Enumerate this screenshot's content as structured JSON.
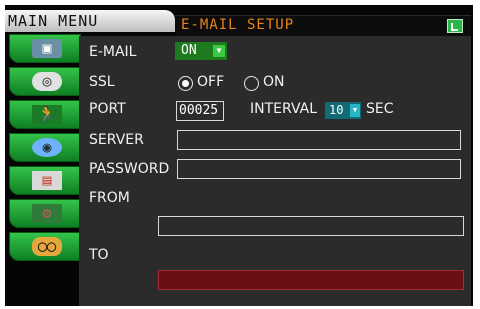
{
  "header": {
    "menu_title": "MAIN MENU",
    "page_title": "E-MAIL SETUP",
    "exit_icon": "exit-icon"
  },
  "sidebar": {
    "items": [
      {
        "icon": "camera-icon"
      },
      {
        "icon": "record-icon"
      },
      {
        "icon": "motion-icon"
      },
      {
        "icon": "network-icon"
      },
      {
        "icon": "file-icon"
      },
      {
        "icon": "tools-icon"
      },
      {
        "icon": "audio-icon"
      }
    ]
  },
  "form": {
    "email_label": "E-MAIL",
    "email_value": "ON",
    "ssl_label": "SSL",
    "ssl_off_label": "OFF",
    "ssl_on_label": "ON",
    "ssl_selected": "OFF",
    "port_label": "PORT",
    "port_value": "00025",
    "interval_label": "INTERVAL",
    "interval_value": "10",
    "interval_unit": "SEC",
    "server_label": "SERVER",
    "server_value": "",
    "password_label": "PASSWORD",
    "password_value": "",
    "from_label": "FROM",
    "from_value": "",
    "to_label": "TO",
    "to_value": ""
  },
  "colors": {
    "accent_title": "#e8841a",
    "sidebar_green": "#1f9c35",
    "active_select": "#1f7a1f",
    "interval_select": "#126b74",
    "to_field": "#6a1015"
  }
}
